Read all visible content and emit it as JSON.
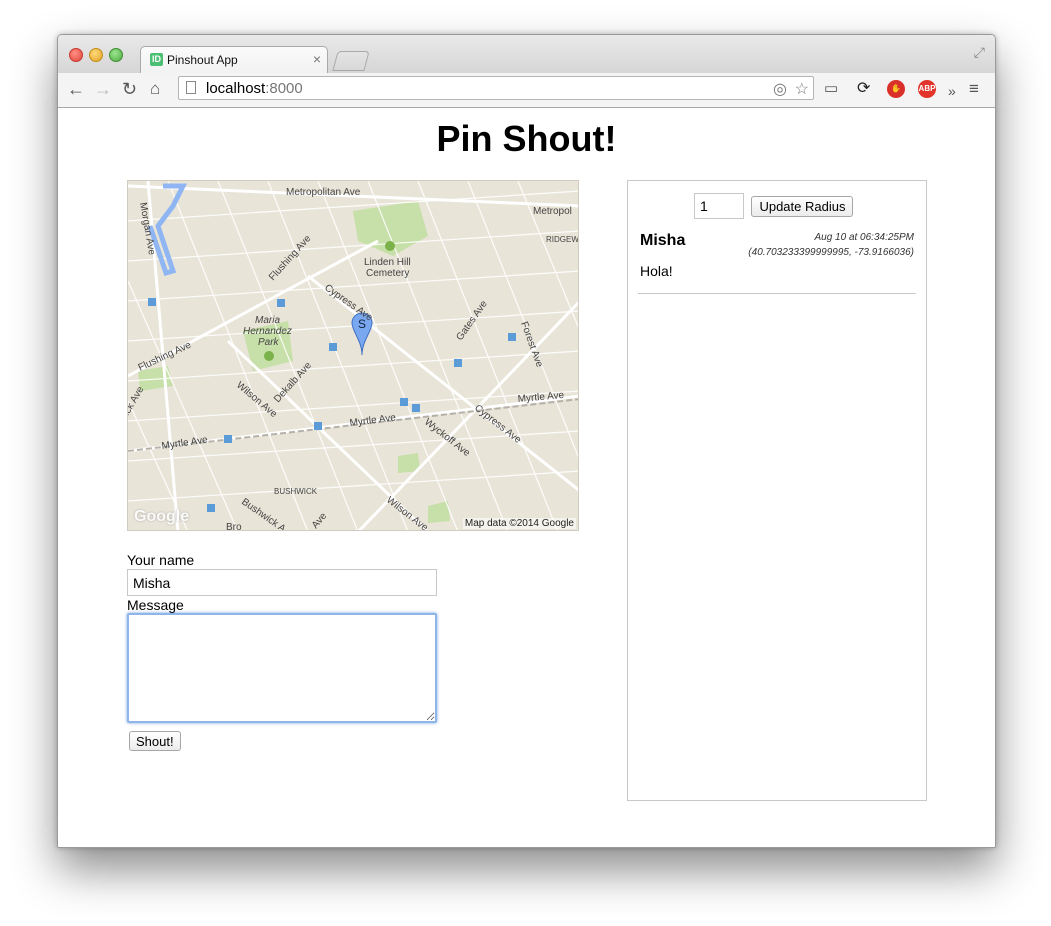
{
  "browser": {
    "tab_title": "Pinshout App",
    "tab_close": "×",
    "url_host": "localhost",
    "url_port": ":8000",
    "ext_stop": "✋",
    "ext_abp": "ABP",
    "overflow": "»"
  },
  "page": {
    "title": "Pin Shout!"
  },
  "map": {
    "attribution": "Map data ©2014 Google",
    "logo": "Google",
    "marker_label": "S",
    "labels": [
      "Metropolitan Ave",
      "Metropol",
      "Morgan Ave",
      "Flushing Ave",
      "Linden Hill",
      "Cemetery",
      "Cypress Ave",
      "Maria",
      "Hernandez",
      "Park",
      "Gates Ave",
      "Forest Ave",
      "RIDGEW",
      "Flushing Ave",
      "Wilson Ave",
      "Dekalb Ave",
      "Myrtle Ave",
      "Myrtle Ave",
      "Wyckoff Ave",
      "Cypress Ave",
      "Myrtle Ave",
      "BUSHWICK",
      "Bushwick A",
      "Wilson Ave",
      "Ave",
      "Bro",
      "ick Ave"
    ]
  },
  "form": {
    "name_label": "Your name",
    "name_value": "Misha",
    "message_label": "Message",
    "message_value": "",
    "submit_label": "Shout!"
  },
  "panel": {
    "radius_value": "1",
    "radius_button": "Update Radius",
    "shouts": [
      {
        "name": "Misha",
        "time": "Aug 10 at 06:34:25PM",
        "coords": "(40.703233399999995, -73.9166036)",
        "message": "Hola!"
      }
    ]
  }
}
